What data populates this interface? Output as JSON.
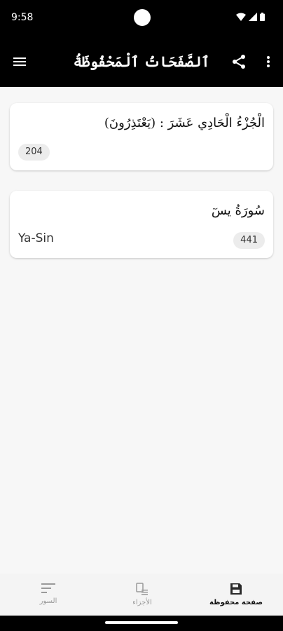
{
  "status_bar": {
    "time": "9:58",
    "icons": [
      "wifi-icon",
      "signal-icon",
      "battery-icon"
    ]
  },
  "app_bar": {
    "title": "ٱلصَّفَحَاتُ ٱلْمَحْفُوظَةُ",
    "icons": [
      "menu-icon",
      "share-icon",
      "more-vert-icon"
    ]
  },
  "saved_pages": [
    {
      "title_ar": "الْجُزْءُ الْحَادِي عَشَرَ : (يَعْتَذِرُونَ)",
      "subtitle": "",
      "page": "204"
    },
    {
      "title_ar": "سُورَةُ يسٓ",
      "subtitle": "Ya-Sin",
      "page": "441"
    }
  ],
  "bottom_nav": {
    "items": [
      {
        "label": "السور",
        "icon": "list-icon",
        "active": false
      },
      {
        "label": "الأجزاء",
        "icon": "juz-icon",
        "active": false
      },
      {
        "label": "صفحة محفوظة",
        "icon": "save-icon",
        "active": true
      }
    ]
  },
  "colors": {
    "header_bg": "#000000",
    "page_bg": "#f7f7f7",
    "badge_bg": "#ececec",
    "inactive": "#999999"
  }
}
